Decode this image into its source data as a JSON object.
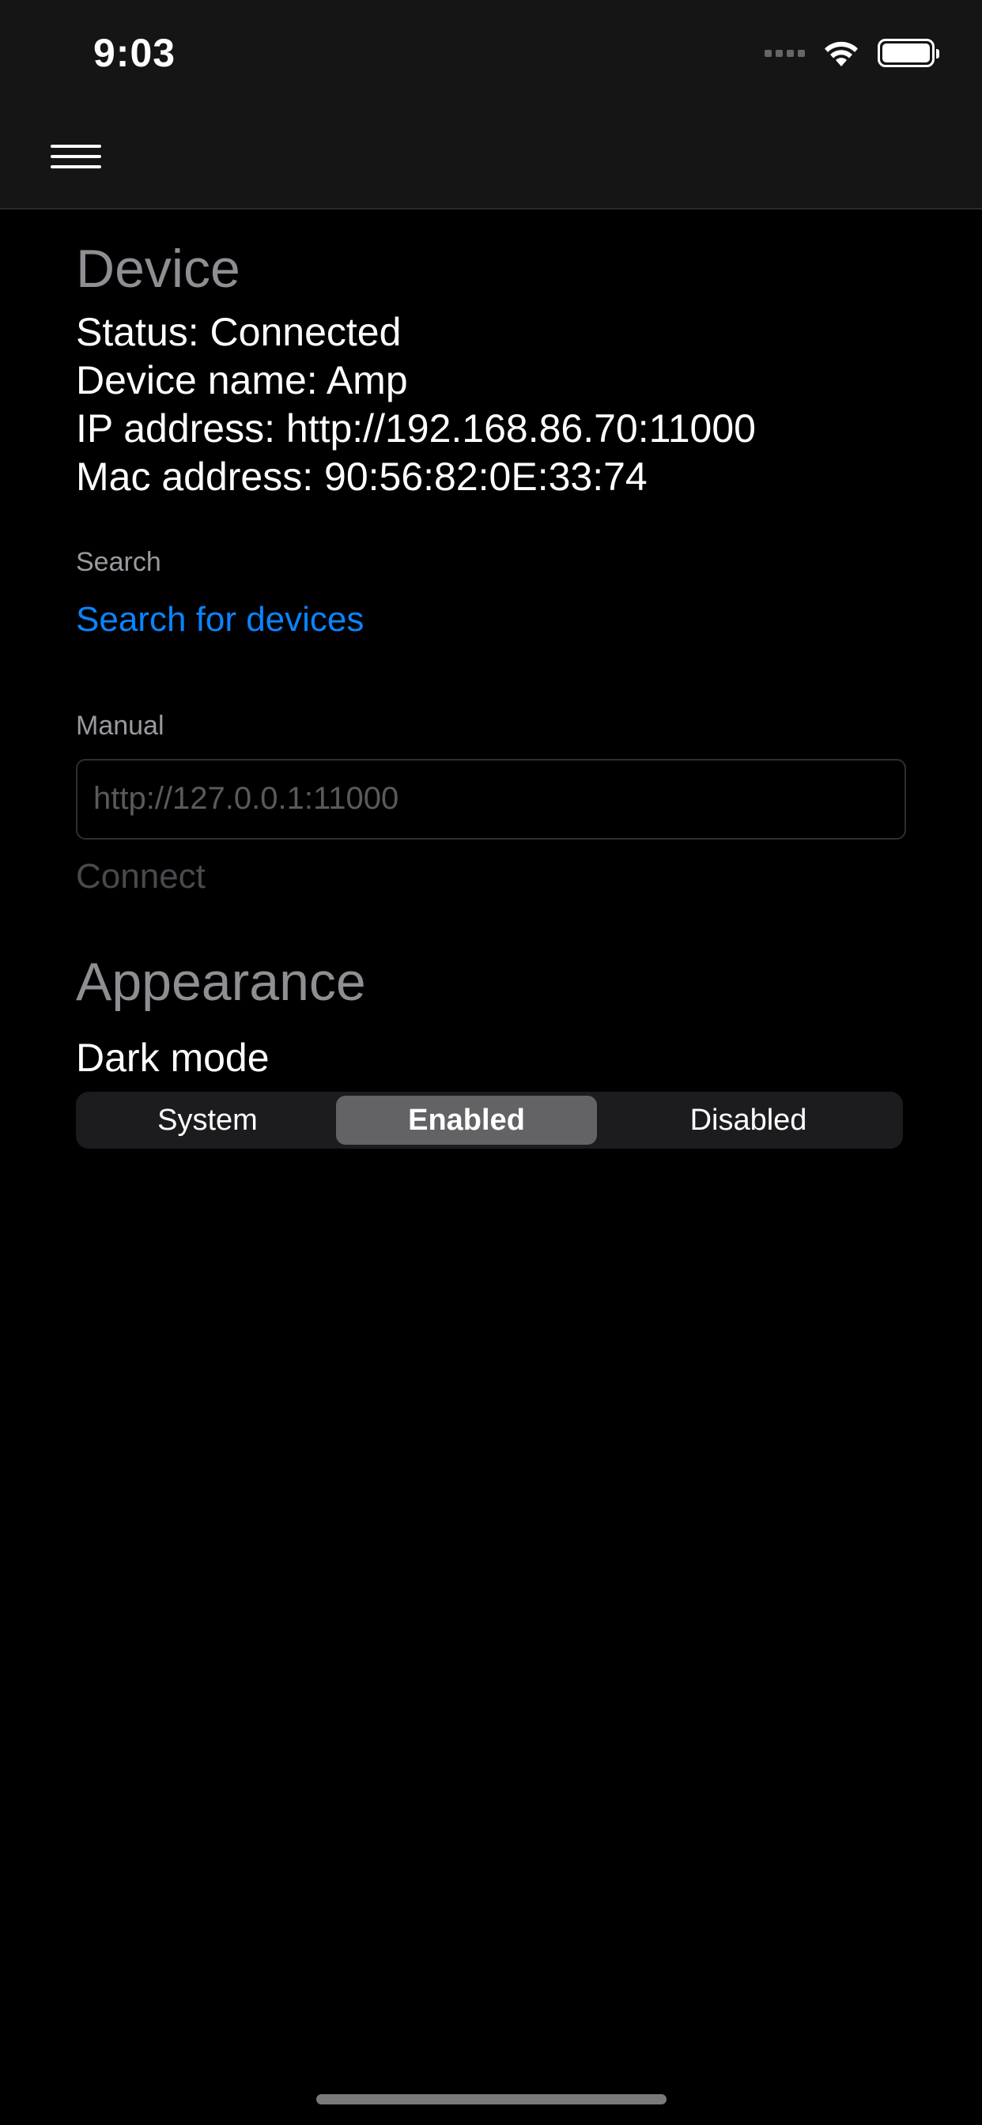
{
  "status_bar": {
    "time": "9:03",
    "icons": [
      "signal-icon",
      "wifi-icon",
      "battery-icon"
    ]
  },
  "nav": {
    "menu_icon": "hamburger-menu-icon"
  },
  "device": {
    "title": "Device",
    "status": "Status: Connected",
    "name": "Device name: Amp",
    "ip": "IP address: http://192.168.86.70:11000",
    "mac": "Mac address: 90:56:82:0E:33:74"
  },
  "search": {
    "label": "Search",
    "link": "Search for devices"
  },
  "manual": {
    "label": "Manual",
    "input_value": "",
    "input_placeholder": "http://127.0.0.1:11000",
    "connect_label": "Connect"
  },
  "appearance": {
    "title": "Appearance",
    "dark_mode_label": "Dark mode",
    "options": [
      "System",
      "Enabled",
      "Disabled"
    ],
    "selected": "Enabled"
  },
  "colors": {
    "background": "#000000",
    "link": "#0a84ff",
    "section_title": "#8e8e93",
    "selected_segment": "#636366"
  }
}
